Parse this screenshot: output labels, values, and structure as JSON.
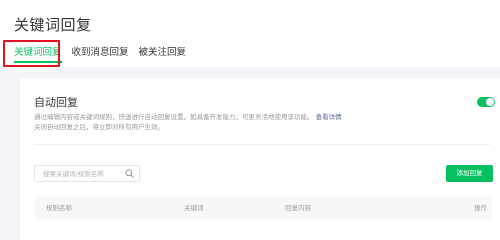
{
  "header": {
    "title": "关键词回复",
    "tabs": [
      {
        "label": "关键词回复",
        "active": true
      },
      {
        "label": "收到消息回复",
        "active": false
      },
      {
        "label": "被关注回复",
        "active": false
      }
    ]
  },
  "auto_reply": {
    "title": "自动回复",
    "description_line1": "通过编辑内容或关键词规则，快速进行自动回复设置。如具备开发能力，可更灵活地使用该功能。",
    "description_link": "查看详情",
    "description_line2": "关闭自动回复之后，将立即对所有用户生效。",
    "toggle_on": true
  },
  "search": {
    "placeholder": "搜索关键词/规则名称"
  },
  "add_button_label": "添加回复",
  "table": {
    "columns": [
      "规则名称",
      "关键词",
      "回复内容",
      "操作"
    ]
  },
  "colors": {
    "accent": "#07c160",
    "highlight": "#e0141e",
    "link": "#576b95"
  }
}
